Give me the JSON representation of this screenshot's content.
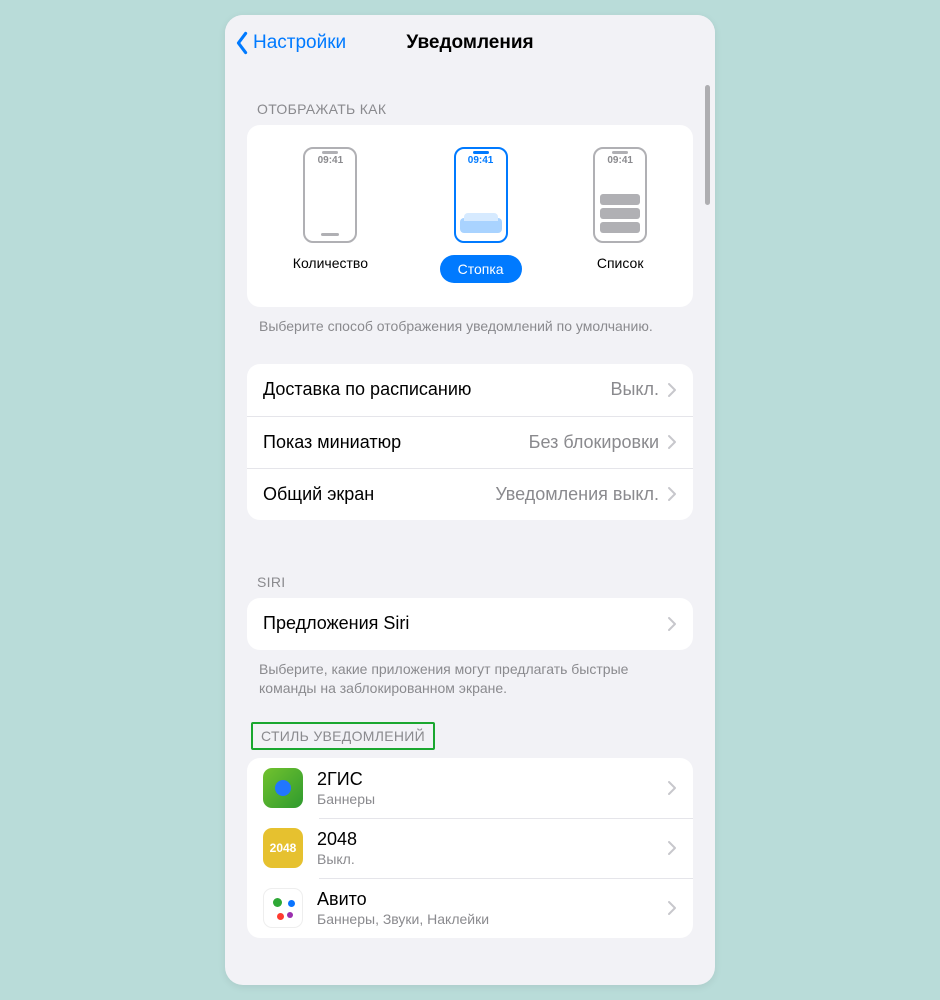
{
  "nav": {
    "back_label": "Настройки",
    "title": "Уведомления"
  },
  "display_as": {
    "header": "ОТОБРАЖАТЬ КАК",
    "time_sample": "09:41",
    "options": [
      {
        "label": "Количество",
        "selected": false
      },
      {
        "label": "Стопка",
        "selected": true
      },
      {
        "label": "Список",
        "selected": false
      }
    ],
    "footer": "Выберите способ отображения уведомлений по умолчанию."
  },
  "delivery": {
    "items": [
      {
        "label": "Доставка по расписанию",
        "value": "Выкл."
      },
      {
        "label": "Показ миниатюр",
        "value": "Без блокировки"
      },
      {
        "label": "Общий экран",
        "value": "Уведомления выкл."
      }
    ]
  },
  "siri": {
    "header": "SIRI",
    "item_label": "Предложения Siri",
    "footer": "Выберите, какие приложения могут предлагать быстрые команды на заблокированном экране."
  },
  "style": {
    "header": "СТИЛЬ УВЕДОМЛЕНИЙ",
    "apps": [
      {
        "name": "2ГИС",
        "sub": "Баннеры",
        "icon": "2gis"
      },
      {
        "name": "2048",
        "sub": "Выкл.",
        "icon": "2048"
      },
      {
        "name": "Авито",
        "sub": "Баннеры, Звуки, Наклейки",
        "icon": "avito"
      }
    ]
  }
}
